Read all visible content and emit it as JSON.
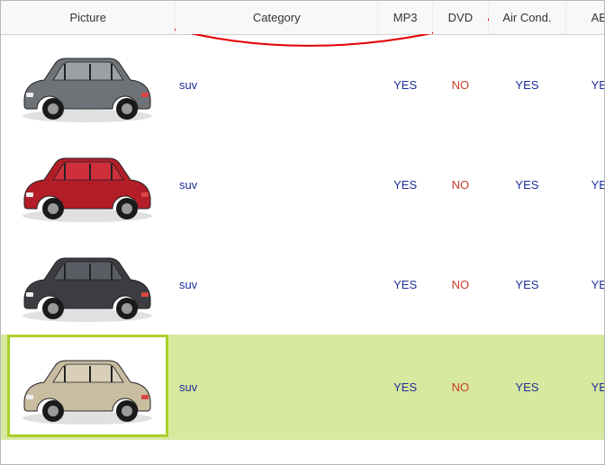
{
  "columns": {
    "picture": "Picture",
    "category": "Category",
    "mp3": "MP3",
    "dvd": "DVD",
    "air": "Air Cond.",
    "abs": "ABS"
  },
  "rows": [
    {
      "car_kind": "silver-suv",
      "category": "suv",
      "mp3": "YES",
      "dvd": "NO",
      "air": "YES",
      "abs": "YES",
      "selected": false
    },
    {
      "car_kind": "red-crossover",
      "category": "suv",
      "mp3": "YES",
      "dvd": "NO",
      "air": "YES",
      "abs": "YES",
      "selected": false
    },
    {
      "car_kind": "dark-suv",
      "category": "suv",
      "mp3": "YES",
      "dvd": "NO",
      "air": "YES",
      "abs": "YES",
      "selected": false
    },
    {
      "car_kind": "beige-suv",
      "category": "suv",
      "mp3": "YES",
      "dvd": "NO",
      "air": "YES",
      "abs": "YES",
      "selected": true
    }
  ],
  "icons": {
    "drag_pointer": "drag-pointer-icon"
  }
}
